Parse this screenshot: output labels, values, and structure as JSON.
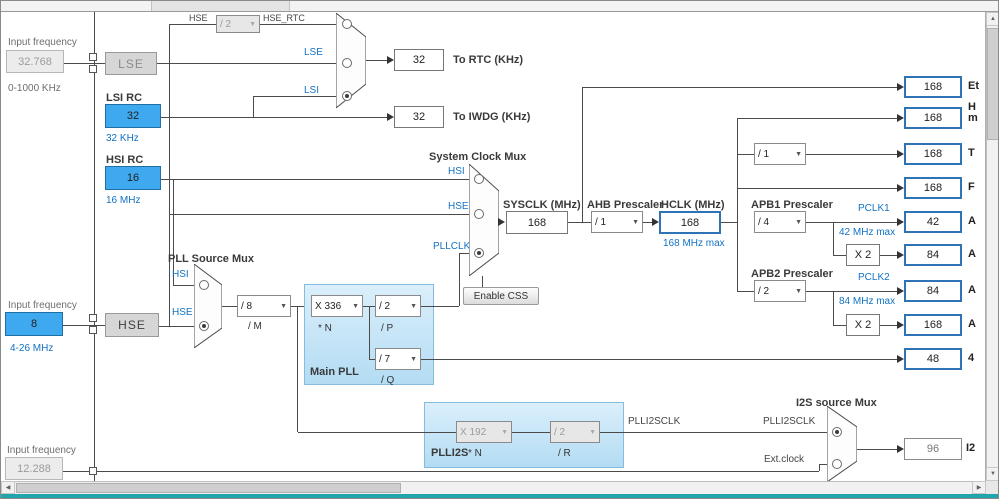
{
  "icons": {
    "up": "▲",
    "down": "▼",
    "left": "◀",
    "right": "▶",
    "chevron": "▼"
  },
  "colors": {
    "highlight": "#3fa9f0",
    "output_border": "#2e74b5",
    "teal_bar": "#1fa6ad",
    "link_blue": "#1272c4"
  },
  "lse": {
    "input_label": "Input frequency",
    "input_value": "32.768",
    "range": "0-1000 KHz",
    "osc": "LSE",
    "wire_label": "LSE"
  },
  "hse": {
    "input_label": "Input frequency",
    "input_value": "8",
    "range": "4-26 MHz",
    "osc": "HSE",
    "top_label": "HSE",
    "rtc_div": "/ 2",
    "rtc_label": "HSE_RTC",
    "sys_wire_label": "HSE",
    "pll_wire_label": "HSE"
  },
  "lsi": {
    "label": "LSI RC",
    "value": "32",
    "freq": "32 KHz",
    "wire_label": "LSI"
  },
  "hsi": {
    "label": "HSI RC",
    "value": "16",
    "freq": "16 MHz",
    "sys_wire_label": "HSI",
    "pll_wire_label": "HSI"
  },
  "rtc": {
    "value": "32",
    "label": "To RTC (KHz)"
  },
  "iwdg": {
    "value": "32",
    "label": "To IWDG (KHz)"
  },
  "pllmux": {
    "title": "PLL Source Mux"
  },
  "pll": {
    "m": "/ 8",
    "m_label": "/ M",
    "panel": "Main PLL",
    "n": "X 336",
    "n_label": "* N",
    "p": "/ 2",
    "p_label": "/ P",
    "q": "/ 7",
    "q_label": "/ Q",
    "pllclk_label": "PLLCLK"
  },
  "sysmux": {
    "title": "System Clock Mux",
    "css_button": "Enable CSS"
  },
  "sysclk": {
    "label": "SYSCLK (MHz)",
    "value": "168"
  },
  "ahb": {
    "label": "AHB Prescaler",
    "value": "/ 1"
  },
  "hclk": {
    "label": "HCLK (MHz)",
    "value": "168",
    "max": "168 MHz max"
  },
  "outputs": {
    "eth": {
      "value": "168",
      "frag": "Et"
    },
    "ahb_bus": {
      "value": "168",
      "frag": "H\nm"
    },
    "cortex_div": "/ 1",
    "cortex": {
      "value": "168",
      "frag": "T"
    },
    "fclk": {
      "value": "168",
      "frag": "F"
    },
    "clk48": {
      "value": "48",
      "frag": "4"
    }
  },
  "apb1": {
    "label": "APB1 Prescaler",
    "value": "/ 4",
    "pclk": "PCLK1",
    "pclk_value": "42",
    "max": "42 MHz max",
    "frag": "A",
    "x2": "X 2",
    "tim_value": "84",
    "tim_frag": "A"
  },
  "apb2": {
    "label": "APB2 Prescaler",
    "value": "/ 2",
    "pclk": "PCLK2",
    "pclk_value": "84",
    "max": "84 MHz max",
    "frag": "A",
    "x2": "X 2",
    "tim_value": "168",
    "tim_frag": "A"
  },
  "plli2s": {
    "panel": "PLLI2S",
    "n": "X 192",
    "n_label": "* N",
    "r": "/ 2",
    "r_label": "/ R",
    "out_label_1": "PLLI2SCLK",
    "out_label_2": "PLLI2SCLK"
  },
  "i2s": {
    "mux_title": "I2S source Mux",
    "ext_label": "Ext.clock",
    "out_value": "96",
    "out_frag": "I2",
    "input_label": "Input frequency",
    "input_value": "12.288"
  }
}
